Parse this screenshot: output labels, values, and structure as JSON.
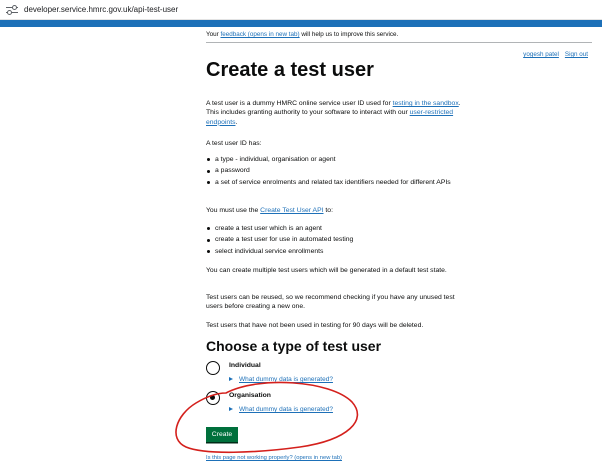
{
  "browser": {
    "url": "developer.service.hmrc.gov.uk/api-test-user"
  },
  "banner": {
    "prefix": "Your ",
    "link": "feedback (opens in new tab)",
    "suffix": " will help us to improve this service."
  },
  "user": {
    "name": "yogesh patel",
    "signout": "Sign out"
  },
  "page": {
    "title": "Create a test user",
    "intro": {
      "t1": "A test user is a dummy HMRC online service user ID used for ",
      "link1": "testing in the sandbox",
      "t2": ". This includes granting authority to your software to interact with our ",
      "link2": "user-restricted endpoints",
      "t3": "."
    },
    "has_heading": "A test user ID has:",
    "has_items": [
      "a type - individual, organisation or agent",
      "a password",
      "a set of service enrolments and related tax identifiers needed for different APIs"
    ],
    "api_text": {
      "t1": "You must use the ",
      "link": "Create Test User API",
      "t2": " to:"
    },
    "api_items": [
      "create a test user which is an agent",
      "create a test user for use in automated testing",
      "select individual service enrollments"
    ],
    "para_multiple": "You can create multiple test users which will be generated in a default test state.",
    "para_reuse": "Test users can be reused, so we recommend checking if you have any unused test users before creating a new one.",
    "para_delete": "Test users that have not been used in testing for 90 days will be deleted."
  },
  "choose": {
    "heading": "Choose a type of test user",
    "options": [
      {
        "label": "Individual",
        "details": "What dummy data is generated?",
        "checked": false
      },
      {
        "label": "Organisation",
        "details": "What dummy data is generated?",
        "checked": true
      }
    ]
  },
  "button": {
    "create": "Create"
  },
  "footer": {
    "problem_link": "Is this page not working properly? (opens in new tab)"
  },
  "colors": {
    "link": "#1d70b8",
    "button": "#00703c",
    "annotation": "#d4201c",
    "header_strip": "#1d70b8"
  }
}
